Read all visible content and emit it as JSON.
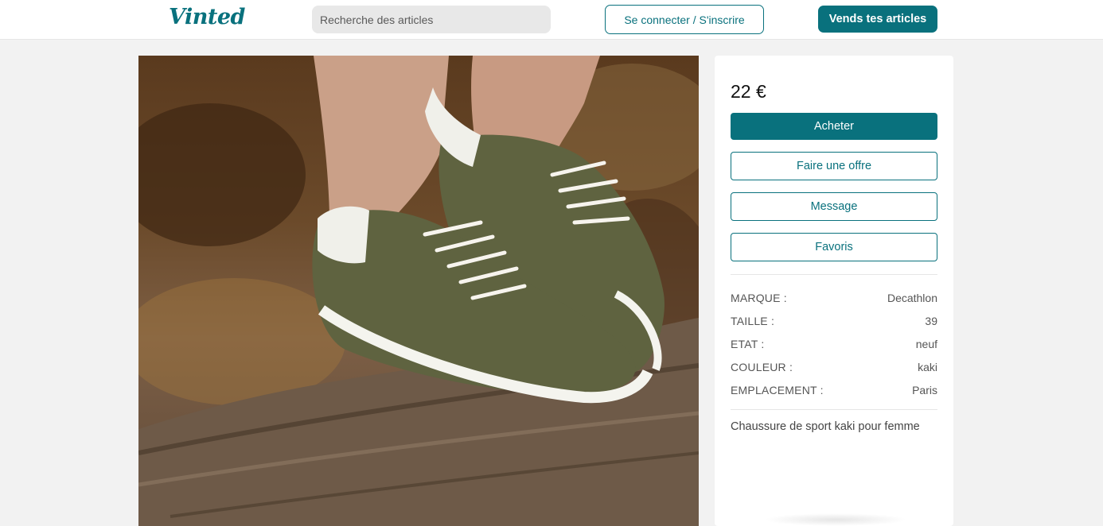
{
  "header": {
    "logo": "Vinted",
    "search_placeholder": "Recherche des articles",
    "login_label": "Se connecter / S'inscrire",
    "sell_label": "Vends tes articles"
  },
  "item": {
    "price": "22 €",
    "actions": {
      "buy": "Acheter",
      "offer": "Faire une offre",
      "message": "Message",
      "favorite": "Favoris"
    },
    "details": [
      {
        "label": "MARQUE :",
        "value": "Decathlon"
      },
      {
        "label": "TAILLE :",
        "value": "39"
      },
      {
        "label": "ETAT :",
        "value": "neuf"
      },
      {
        "label": "COULEUR :",
        "value": "kaki"
      },
      {
        "label": "EMPLACEMENT :",
        "value": "Paris"
      }
    ],
    "description": "Chaussure de sport kaki pour femme",
    "photo_icon": "khaki-sneaker-photo"
  },
  "colors": {
    "brand": "#09717d",
    "shoe": "#5f6340",
    "background": "#f2f2f2"
  }
}
